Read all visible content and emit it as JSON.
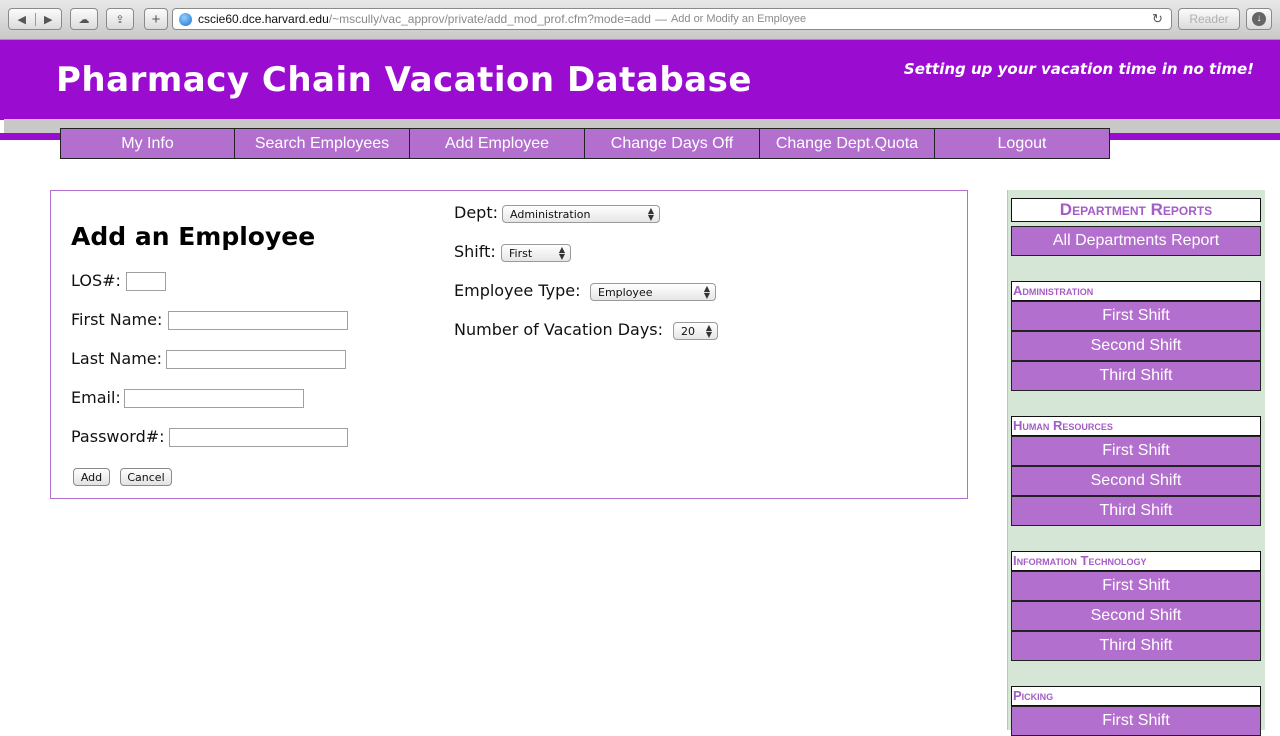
{
  "browser": {
    "url_host": "cscie60.dce.harvard.edu",
    "url_path": "/~mscully/vac_approv/private/add_mod_prof.cfm?mode=add",
    "page_title": "Add or Modify an Employee",
    "reader_label": "Reader"
  },
  "header": {
    "title": "Pharmacy Chain Vacation Database",
    "tagline": "Setting up your vacation time in no time!"
  },
  "nav": [
    "My Info",
    "Search Employees",
    "Add Employee",
    "Change Days Off",
    "Change Dept.Quota",
    "Logout"
  ],
  "form": {
    "heading": "Add an Employee",
    "los_label": "LOS#:",
    "first_name_label": "First Name:",
    "last_name_label": "Last Name:",
    "email_label": "Email:",
    "password_label": "Password#:",
    "add_button": "Add",
    "cancel_button": "Cancel",
    "dept_label": "Dept:",
    "dept_value": "Administration",
    "shift_label": "Shift:",
    "shift_value": "First",
    "emp_type_label": "Employee Type:",
    "emp_type_value": "Employee",
    "vac_days_label": "Number of Vacation Days:",
    "vac_days_value": "20"
  },
  "sidebar": {
    "reports_heading": "Department Reports",
    "all_departments": "All Departments Report",
    "departments": [
      {
        "name": "Administration",
        "shifts": [
          "First Shift",
          "Second Shift",
          "Third Shift"
        ]
      },
      {
        "name": "Human Resources",
        "shifts": [
          "First Shift",
          "Second Shift",
          "Third Shift"
        ]
      },
      {
        "name": "Information Technology",
        "shifts": [
          "First Shift",
          "Second Shift",
          "Third Shift"
        ]
      },
      {
        "name": "Picking",
        "shifts": [
          "First Shift"
        ]
      }
    ]
  }
}
